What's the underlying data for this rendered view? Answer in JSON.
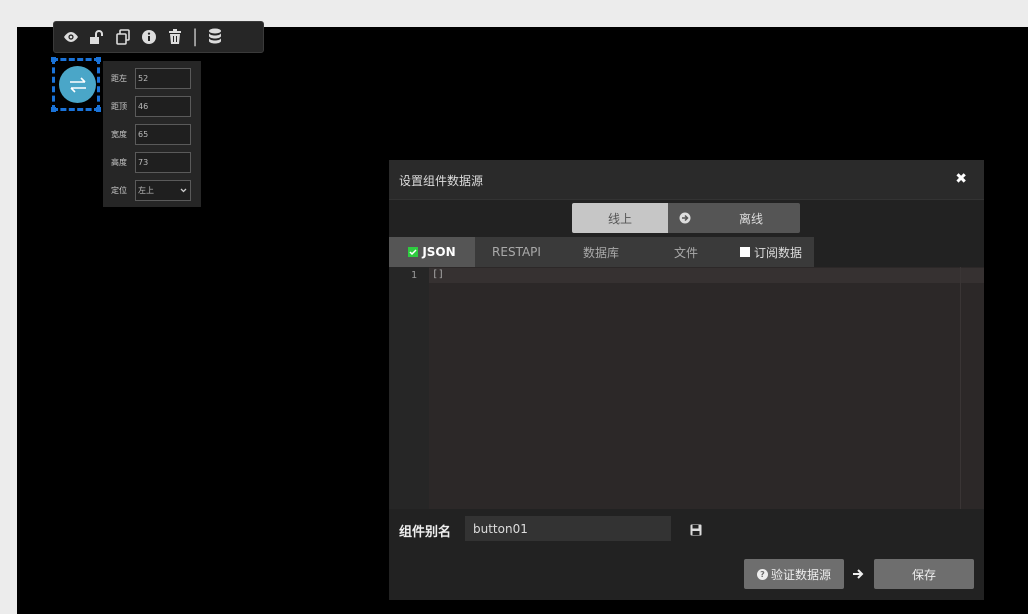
{
  "toolbar": {
    "icons": [
      "eye-icon",
      "unlock-icon",
      "copy-icon",
      "info-icon",
      "trash-icon",
      "database-icon"
    ],
    "separator": "|"
  },
  "widget": {
    "icon": "swap-arrows-icon",
    "accent_color": "#4aa6c8",
    "selection_color": "#1a73d9"
  },
  "position_panel": {
    "fields": [
      {
        "label": "距左",
        "value": "52"
      },
      {
        "label": "距顶",
        "value": "46"
      },
      {
        "label": "宽度",
        "value": "65"
      },
      {
        "label": "高度",
        "value": "73"
      }
    ],
    "anchor": {
      "label": "定位",
      "value": "左上"
    }
  },
  "dialog": {
    "title": "设置组件数据源",
    "close_symbol": "✖",
    "mode": {
      "online": "线上",
      "offline": "离线"
    },
    "tabs": [
      {
        "label": "JSON",
        "active": true,
        "checked": true
      },
      {
        "label": "RESTAPI",
        "active": false
      },
      {
        "label": "数据库",
        "active": false
      },
      {
        "label": "文件",
        "active": false
      },
      {
        "label": "订阅数据",
        "active": false,
        "checked": false
      }
    ],
    "editor": {
      "line_number": "1",
      "content": "[]"
    },
    "alias": {
      "label": "组件别名",
      "value": "button01"
    },
    "verify_button": "验证数据源",
    "save_button": "保存"
  }
}
